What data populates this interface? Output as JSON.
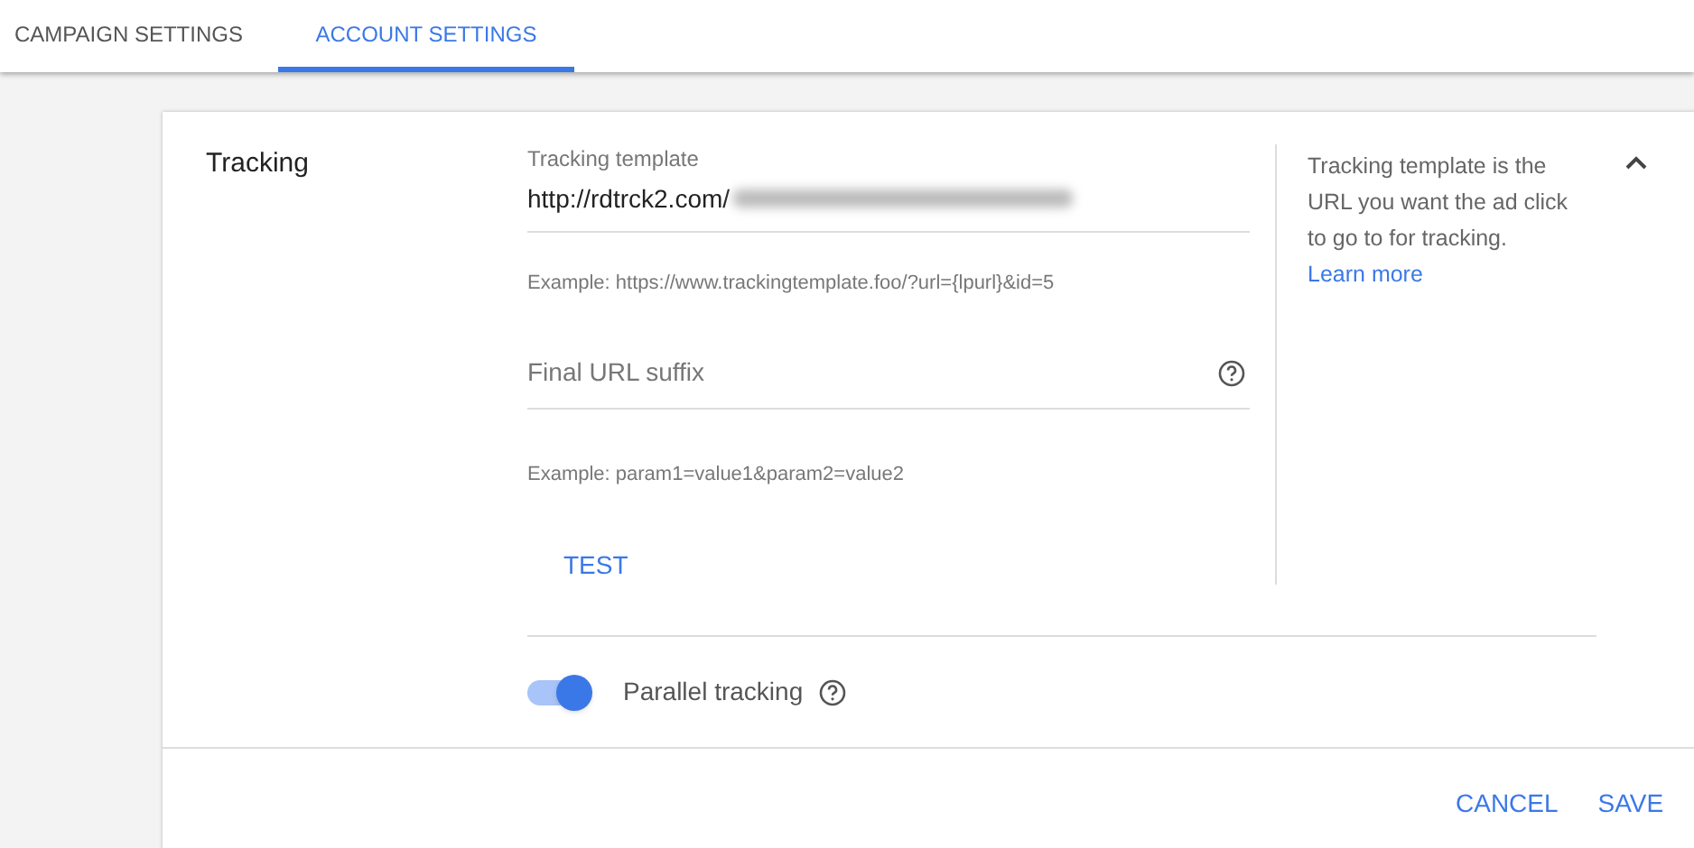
{
  "tabs": [
    {
      "label": "CAMPAIGN SETTINGS",
      "selected": false
    },
    {
      "label": "ACCOUNT SETTINGS",
      "selected": true
    }
  ],
  "section": {
    "title": "Tracking",
    "expanded": true,
    "fields": [
      {
        "label": "Tracking template",
        "value": "http://rdtrck2.com/",
        "hint": "Example: https://www.trackingtemplate.foo/?url={lpurl}&id=5"
      },
      {
        "placeholder": "Final URL suffix",
        "hint": "Example: param1=value1&param2=value2"
      }
    ],
    "test_button": "TEST",
    "help_text": "Tracking template is the URL you want the ad click to go to for tracking.",
    "help_link": "Learn more",
    "parallel_tracking": {
      "label": "Parallel tracking",
      "on": true
    }
  },
  "buttons": [
    "CANCEL",
    "SAVE"
  ]
}
